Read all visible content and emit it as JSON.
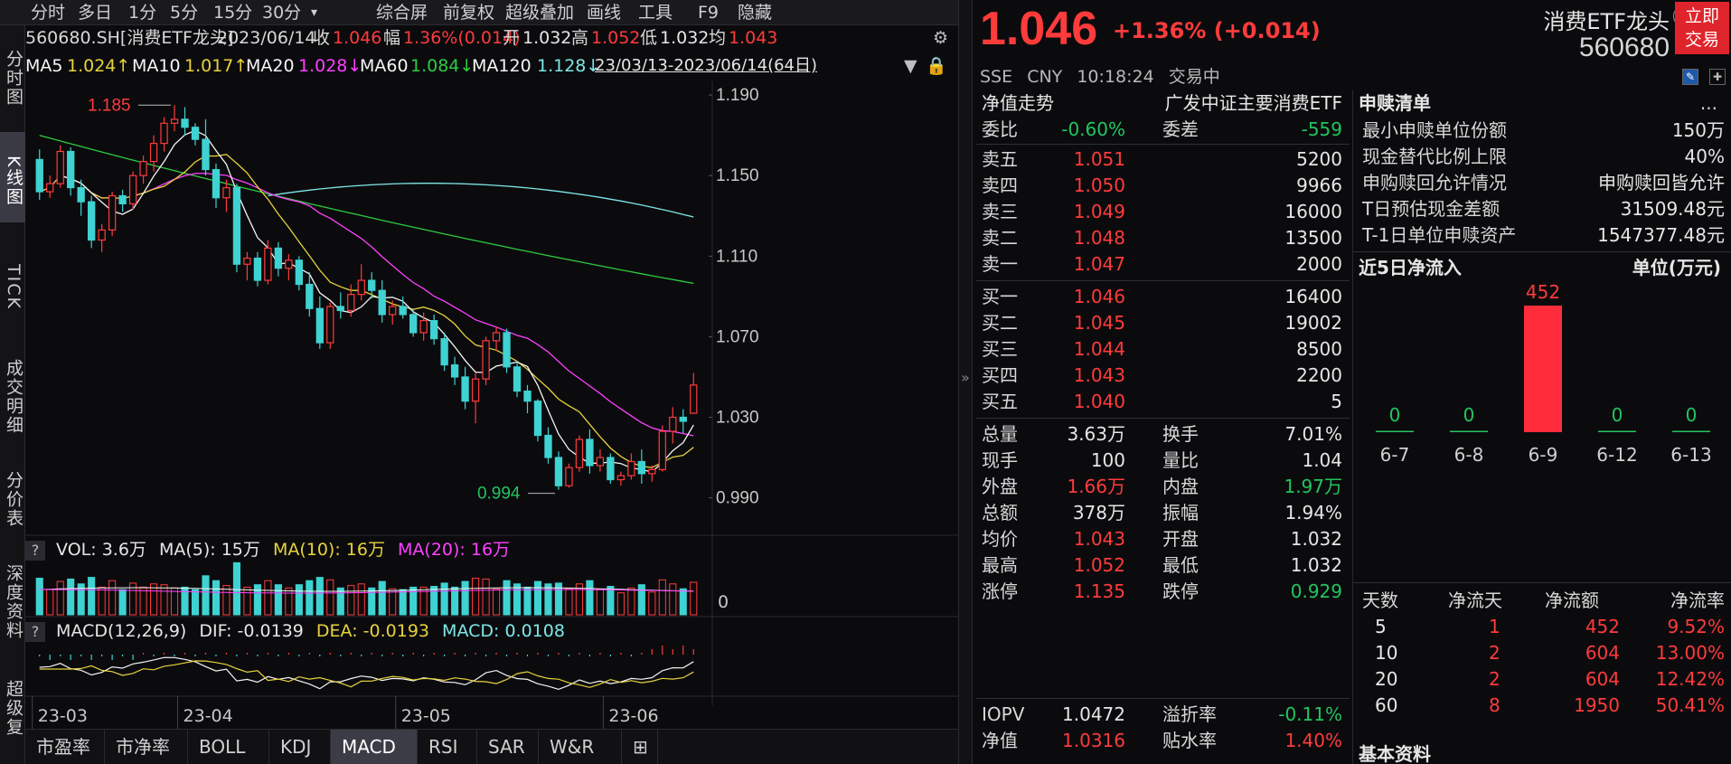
{
  "periods": [
    "分时",
    "多日",
    "1分",
    "5分",
    "15分",
    "30分"
  ],
  "toolbar": [
    "综合屏",
    "前复权",
    "超级叠加",
    "画线",
    "工具",
    "F9",
    "隐藏"
  ],
  "dropdown_glyph": "▾",
  "left_nav": [
    {
      "label": "分时图",
      "active": false
    },
    {
      "label": "K线图",
      "active": true
    },
    {
      "label": "TICK",
      "active": false
    },
    {
      "label": "成交明细",
      "active": false
    },
    {
      "label": "分价表",
      "active": false
    },
    {
      "label": "深度资料",
      "active": false
    },
    {
      "label": "超级复",
      "active": false
    }
  ],
  "info_bar": {
    "code_name": "560680.SH[消费ETF龙头]",
    "date": "2023/06/14",
    "close_label": "收",
    "close": "1.046",
    "amp_label": "幅",
    "amp": "1.36%(0.014)",
    "open_label": "开",
    "open": "1.032",
    "high_label": "高",
    "high": "1.052",
    "low_label": "低",
    "low": "1.032",
    "avg_label": "均",
    "avg": "1.043"
  },
  "ma_bar": {
    "ma5_label": "MA5",
    "ma5": "1.024↑",
    "ma10_label": "MA10",
    "ma10": "1.017↑",
    "ma20_label": "MA20",
    "ma20": "1.028↓",
    "ma60_label": "MA60",
    "ma60": "1.084↓",
    "ma120_label": "MA120",
    "ma120": "1.128↓",
    "range": "23/03/13-2023/06/14(64日)"
  },
  "colors": {
    "up": "#ff3b3b",
    "down": "#3fd2d2",
    "ma5": "#f5f5f5",
    "ma10": "#e8d23c",
    "ma20": "#ff40ff",
    "ma60": "#2ecc40",
    "ma120": "#7fe7e7",
    "text_yellow": "#e8d23c",
    "text_magenta": "#ff40ff",
    "bg": "#0b0b0e"
  },
  "chart_data": {
    "type": "candlestick",
    "y_ticks": [
      "1.190",
      "1.150",
      "1.110",
      "1.070",
      "1.030",
      "0.990"
    ],
    "ylim": [
      0.975,
      1.195
    ],
    "x_labels": [
      "23-03",
      "23-04",
      "23-05",
      "23-06"
    ],
    "x_label_index": [
      0,
      14,
      35,
      55
    ],
    "annotations": [
      {
        "text": "1.185",
        "index": 13,
        "value": 1.185
      },
      {
        "text": "0.994",
        "index": 50,
        "value": 0.994
      }
    ],
    "ohlc": [
      [
        1.158,
        1.163,
        1.138,
        1.142
      ],
      [
        1.142,
        1.15,
        1.139,
        1.146
      ],
      [
        1.146,
        1.165,
        1.144,
        1.162
      ],
      [
        1.162,
        1.164,
        1.14,
        1.144
      ],
      [
        1.144,
        1.148,
        1.13,
        1.137
      ],
      [
        1.137,
        1.14,
        1.114,
        1.118
      ],
      [
        1.118,
        1.126,
        1.112,
        1.123
      ],
      [
        1.123,
        1.142,
        1.12,
        1.14
      ],
      [
        1.14,
        1.143,
        1.132,
        1.136
      ],
      [
        1.136,
        1.152,
        1.133,
        1.15
      ],
      [
        1.15,
        1.16,
        1.146,
        1.157
      ],
      [
        1.157,
        1.17,
        1.152,
        1.166
      ],
      [
        1.166,
        1.179,
        1.162,
        1.176
      ],
      [
        1.176,
        1.185,
        1.172,
        1.178
      ],
      [
        1.178,
        1.184,
        1.17,
        1.174
      ],
      [
        1.174,
        1.176,
        1.165,
        1.168
      ],
      [
        1.168,
        1.178,
        1.15,
        1.153
      ],
      [
        1.153,
        1.156,
        1.134,
        1.139
      ],
      [
        1.139,
        1.148,
        1.132,
        1.144
      ],
      [
        1.144,
        1.146,
        1.102,
        1.106
      ],
      [
        1.106,
        1.112,
        1.098,
        1.109
      ],
      [
        1.109,
        1.112,
        1.095,
        1.098
      ],
      [
        1.098,
        1.118,
        1.096,
        1.114
      ],
      [
        1.114,
        1.117,
        1.1,
        1.104
      ],
      [
        1.104,
        1.111,
        1.098,
        1.108
      ],
      [
        1.108,
        1.11,
        1.093,
        1.096
      ],
      [
        1.096,
        1.102,
        1.08,
        1.084
      ],
      [
        1.084,
        1.09,
        1.064,
        1.067
      ],
      [
        1.067,
        1.087,
        1.064,
        1.085
      ],
      [
        1.085,
        1.092,
        1.079,
        1.083
      ],
      [
        1.083,
        1.096,
        1.08,
        1.091
      ],
      [
        1.091,
        1.106,
        1.088,
        1.098
      ],
      [
        1.098,
        1.102,
        1.089,
        1.093
      ],
      [
        1.093,
        1.098,
        1.077,
        1.081
      ],
      [
        1.081,
        1.088,
        1.076,
        1.085
      ],
      [
        1.085,
        1.09,
        1.079,
        1.081
      ],
      [
        1.081,
        1.084,
        1.07,
        1.072
      ],
      [
        1.072,
        1.082,
        1.068,
        1.078
      ],
      [
        1.078,
        1.081,
        1.066,
        1.069
      ],
      [
        1.069,
        1.072,
        1.053,
        1.056
      ],
      [
        1.056,
        1.06,
        1.046,
        1.05
      ],
      [
        1.05,
        1.055,
        1.034,
        1.038
      ],
      [
        1.038,
        1.052,
        1.027,
        1.049
      ],
      [
        1.049,
        1.07,
        1.046,
        1.068
      ],
      [
        1.068,
        1.075,
        1.063,
        1.072
      ],
      [
        1.072,
        1.074,
        1.052,
        1.055
      ],
      [
        1.055,
        1.058,
        1.04,
        1.043
      ],
      [
        1.043,
        1.046,
        1.032,
        1.038
      ],
      [
        1.038,
        1.039,
        1.018,
        1.021
      ],
      [
        1.021,
        1.025,
        1.007,
        1.01
      ],
      [
        1.01,
        1.013,
        0.994,
        0.996
      ],
      [
        0.996,
        1.007,
        0.995,
        1.005
      ],
      [
        1.005,
        1.021,
        1.003,
        1.019
      ],
      [
        1.019,
        1.024,
        1.002,
        1.006
      ],
      [
        1.006,
        1.014,
        1.003,
        1.01
      ],
      [
        1.01,
        1.012,
        0.997,
        0.999
      ],
      [
        0.999,
        1.003,
        0.996,
        1.001
      ],
      [
        1.001,
        1.012,
        0.999,
        1.008
      ],
      [
        1.008,
        1.014,
        0.997,
        1.002
      ],
      [
        1.002,
        1.006,
        0.998,
        1.004
      ],
      [
        1.004,
        1.026,
        1.003,
        1.023
      ],
      [
        1.023,
        1.035,
        1.017,
        1.03
      ],
      [
        1.03,
        1.034,
        1.022,
        1.028
      ],
      [
        1.032,
        1.052,
        1.032,
        1.046
      ]
    ]
  },
  "volume": {
    "legend_vol": "VOL: 3.6万",
    "legend_ma5": "MA(5): 15万",
    "legend_ma10": "MA(10): 16万",
    "legend_ma20": "MA(20): 16万",
    "axis_zero": "0"
  },
  "macd": {
    "legend_title": "MACD(12,26,9)",
    "dif": "DIF: -0.0139",
    "dea": "DEA: -0.0193",
    "macd": "MACD: 0.0108"
  },
  "bottom_tabs": [
    {
      "label": "市盈率",
      "active": false
    },
    {
      "label": "市净率",
      "active": false
    },
    {
      "label": "BOLL",
      "active": false
    },
    {
      "label": "KDJ",
      "active": false
    },
    {
      "label": "MACD",
      "active": true
    },
    {
      "label": "RSI",
      "active": false
    },
    {
      "label": "SAR",
      "active": false
    },
    {
      "label": "W&R",
      "active": false
    },
    {
      "label": "⊞",
      "active": false
    }
  ],
  "collapse_glyph": "»",
  "header": {
    "price": "1.046",
    "change": "+1.36% (+0.014)",
    "exchange": "SSE",
    "currency": "CNY",
    "time": "10:18:24",
    "status": "交易中",
    "name": "消费ETF龙头",
    "code": "560680",
    "info_glyph": "!",
    "trade_button": "立即交易",
    "icon_a": "✎",
    "icon_b": "✚"
  },
  "quotes": {
    "nav_trend": "净值走势",
    "index_name": "广发中证主要消费ETF",
    "weibi_label": "委比",
    "weibi": "-0.60%",
    "weicha_label": "委差",
    "weicha": "-559",
    "asks": [
      {
        "label": "卖五",
        "price": "1.051",
        "vol": "5200"
      },
      {
        "label": "卖四",
        "price": "1.050",
        "vol": "9966"
      },
      {
        "label": "卖三",
        "price": "1.049",
        "vol": "16000"
      },
      {
        "label": "卖二",
        "price": "1.048",
        "vol": "13500"
      },
      {
        "label": "卖一",
        "price": "1.047",
        "vol": "2000"
      }
    ],
    "bids": [
      {
        "label": "买一",
        "price": "1.046",
        "vol": "16400"
      },
      {
        "label": "买二",
        "price": "1.045",
        "vol": "19002"
      },
      {
        "label": "买三",
        "price": "1.044",
        "vol": "8500"
      },
      {
        "label": "买四",
        "price": "1.043",
        "vol": "2200"
      },
      {
        "label": "买五",
        "price": "1.040",
        "vol": "5"
      }
    ],
    "stats": [
      {
        "l1": "总量",
        "v1": "3.63万",
        "c1": "white",
        "l2": "换手",
        "v2": "7.01%",
        "c2": "white"
      },
      {
        "l1": "现手",
        "v1": "100",
        "c1": "white",
        "l2": "量比",
        "v2": "1.04",
        "c2": "white"
      },
      {
        "l1": "外盘",
        "v1": "1.66万",
        "c1": "red",
        "l2": "内盘",
        "v2": "1.97万",
        "c2": "green"
      },
      {
        "l1": "总额",
        "v1": "378万",
        "c1": "white",
        "l2": "振幅",
        "v2": "1.94%",
        "c2": "white"
      },
      {
        "l1": "均价",
        "v1": "1.043",
        "c1": "red",
        "l2": "开盘",
        "v2": "1.032",
        "c2": "white"
      },
      {
        "l1": "最高",
        "v1": "1.052",
        "c1": "red",
        "l2": "最低",
        "v2": "1.032",
        "c2": "white"
      },
      {
        "l1": "涨停",
        "v1": "1.135",
        "c1": "red",
        "l2": "跌停",
        "v2": "0.929",
        "c2": "green"
      }
    ],
    "iopv_label": "IOPV",
    "iopv": "1.0472",
    "premium_label": "溢折率",
    "premium": "-0.11%",
    "nav_label": "净值",
    "nav": "1.0316",
    "discount_label": "贴水率",
    "discount": "1.40%"
  },
  "right": {
    "title": "申赎清单",
    "more": "...",
    "items": [
      {
        "label": "最小申赎单位份额",
        "value": "150万"
      },
      {
        "label": "现金替代比例上限",
        "value": "40%"
      },
      {
        "label": "申购赎回允许情况",
        "value": "申购赎回皆允许"
      },
      {
        "label": "T日预估现金差额",
        "value": "31509.48元"
      },
      {
        "label": "T-1日单位申赎资产",
        "value": "1547377.48元"
      }
    ],
    "flow_title": "近5日净流入",
    "flow_unit": "单位(万元)",
    "flow_days": [
      "6-7",
      "6-8",
      "6-9",
      "6-12",
      "6-13"
    ],
    "flow_values": [
      0,
      0,
      452,
      0,
      0
    ],
    "table_head": [
      "天数",
      "净流天",
      "净流额",
      "净流率"
    ],
    "table_rows": [
      [
        "5",
        "1",
        "452",
        "9.52%"
      ],
      [
        "10",
        "2",
        "604",
        "13.00%"
      ],
      [
        "20",
        "2",
        "604",
        "12.42%"
      ],
      [
        "60",
        "8",
        "1950",
        "50.41%"
      ]
    ],
    "footer": "基本资料"
  }
}
